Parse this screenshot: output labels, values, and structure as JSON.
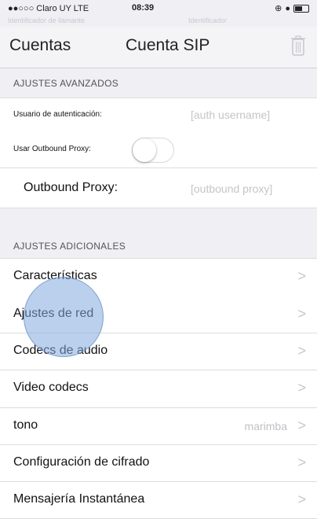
{
  "status_bar": {
    "carrier": "●●○○○ Claro UY  LTE",
    "time": "08:39",
    "ghost_left": "Identificador de llamante",
    "ghost_right": "Identificador"
  },
  "nav": {
    "back_label": "Cuentas",
    "title": "Cuenta SIP"
  },
  "advanced": {
    "header": "AJUSTES AVANZADOS",
    "auth_label": "Usuario de autenticación:",
    "auth_placeholder": "[auth username]",
    "outbound_toggle_label": "Usar Outbound Proxy:",
    "outbound_toggle_on": false,
    "outbound_label": "Outbound Proxy:",
    "outbound_placeholder": "[outbound proxy]"
  },
  "additional": {
    "header": "AJUSTES ADICIONALES",
    "items": [
      {
        "label": "Características",
        "value": ""
      },
      {
        "label": "Ajustes de red",
        "value": ""
      },
      {
        "label": "Codecs de audio",
        "value": ""
      },
      {
        "label": "Video codecs",
        "value": ""
      },
      {
        "label": "tono",
        "value": "marimba"
      },
      {
        "label": "Configuración de cifrado",
        "value": ""
      },
      {
        "label": "Mensajería Instantánea",
        "value": ""
      }
    ]
  },
  "chevron": ">"
}
